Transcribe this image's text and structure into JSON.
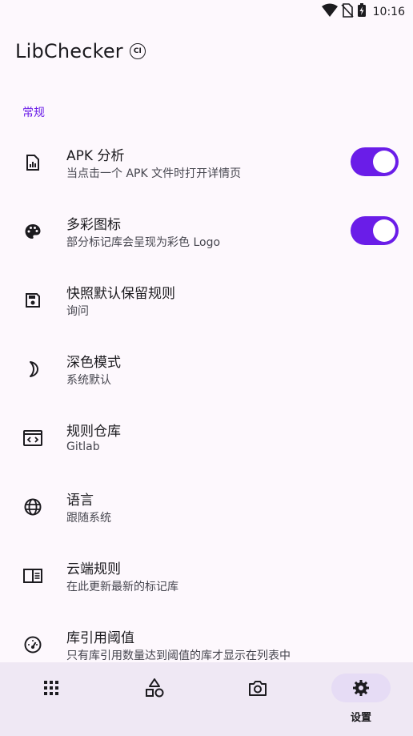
{
  "status_bar": {
    "time": "10:16"
  },
  "app": {
    "title": "LibChecker",
    "badge": "CI"
  },
  "section": {
    "header": "常规"
  },
  "settings": [
    {
      "title": "APK 分析",
      "subtitle": "当点击一个 APK 文件时打开详情页",
      "icon": "apk-analysis-icon",
      "toggle": true
    },
    {
      "title": "多彩图标",
      "subtitle": "部分标记库会呈现为彩色 Logo",
      "icon": "palette-icon",
      "toggle": true
    },
    {
      "title": "快照默认保留规则",
      "subtitle": "询问",
      "icon": "save-icon"
    },
    {
      "title": "深色模式",
      "subtitle": "系统默认",
      "icon": "dark-mode-icon"
    },
    {
      "title": "规则仓库",
      "subtitle": "Gitlab",
      "icon": "code-window-icon"
    },
    {
      "title": "语言",
      "subtitle": "跟随系统",
      "icon": "globe-icon"
    },
    {
      "title": "云端规则",
      "subtitle": "在此更新最新的标记库",
      "icon": "cloud-rules-icon"
    },
    {
      "title": "库引用阈值",
      "subtitle": "只有库引用数量达到阈值的库才显示在列表中",
      "icon": "gauge-icon"
    }
  ],
  "bottom_nav": {
    "items": [
      {
        "icon": "apps-grid-icon"
      },
      {
        "icon": "shapes-icon"
      },
      {
        "icon": "camera-icon"
      },
      {
        "icon": "gear-icon",
        "label": "设置",
        "active": true
      }
    ]
  },
  "colors": {
    "accent": "#6a1de8",
    "background": "#fdf8fd",
    "nav_background": "#efe8f4"
  }
}
